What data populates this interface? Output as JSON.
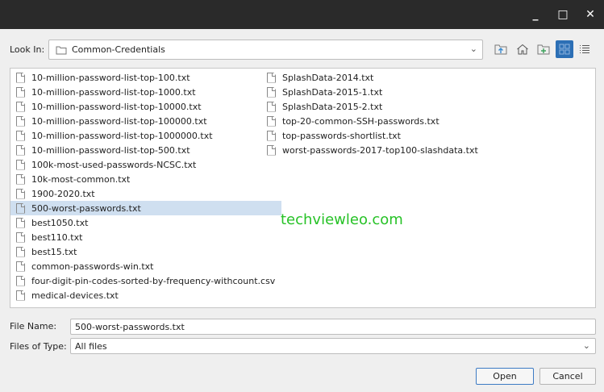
{
  "window": {
    "minimize": "_",
    "maximize": "□",
    "close": "✕"
  },
  "look_in": {
    "label": "Look In:",
    "value": "Common-Credentials"
  },
  "toolbar": {
    "icons": [
      "folder-up-icon",
      "home-icon",
      "new-folder-icon",
      "icon-view-icon",
      "list-view-icon"
    ]
  },
  "files": {
    "col1": [
      "10-million-password-list-top-100.txt",
      "10-million-password-list-top-1000.txt",
      "10-million-password-list-top-10000.txt",
      "10-million-password-list-top-100000.txt",
      "10-million-password-list-top-1000000.txt",
      "10-million-password-list-top-500.txt",
      "100k-most-used-passwords-NCSC.txt",
      "10k-most-common.txt",
      "1900-2020.txt",
      "500-worst-passwords.txt",
      "best1050.txt",
      "best110.txt",
      "best15.txt",
      "common-passwords-win.txt",
      "four-digit-pin-codes-sorted-by-frequency-withcount.csv",
      "medical-devices.txt"
    ],
    "col2": [
      "SplashData-2014.txt",
      "SplashData-2015-1.txt",
      "SplashData-2015-2.txt",
      "top-20-common-SSH-passwords.txt",
      "top-passwords-shortlist.txt",
      "worst-passwords-2017-top100-slashdata.txt"
    ],
    "selected": "500-worst-passwords.txt"
  },
  "watermark": "techviewleo.com",
  "file_name": {
    "label": "File Name:",
    "value": "500-worst-passwords.txt"
  },
  "file_type": {
    "label": "Files of Type:",
    "value": "All files"
  },
  "buttons": {
    "open": "Open",
    "cancel": "Cancel"
  }
}
